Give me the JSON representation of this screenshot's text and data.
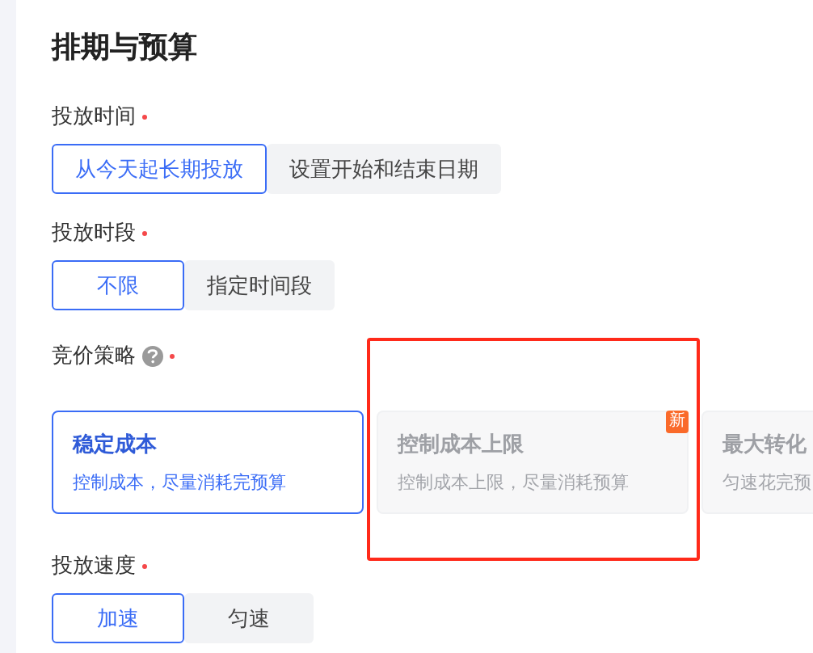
{
  "title": "排期与预算",
  "sections": [
    {
      "kind": "segmented",
      "label": "投放时间",
      "required": true,
      "options": [
        {
          "label": "从今天起长期投放",
          "selected": true
        },
        {
          "label": "设置开始和结束日期",
          "selected": false
        }
      ]
    },
    {
      "kind": "segmented",
      "label": "投放时段",
      "required": true,
      "options": [
        {
          "label": "不限",
          "selected": true
        },
        {
          "label": "指定时间段",
          "selected": false
        }
      ]
    },
    {
      "kind": "cards",
      "label": "竞价策略",
      "help": true,
      "required": true,
      "cards": [
        {
          "title": "稳定成本",
          "desc": "控制成本，尽量消耗完预算",
          "selected": true,
          "disabled": false,
          "highlighted": false
        },
        {
          "title": "控制成本上限",
          "desc": "控制成本上限，尽量消耗预算",
          "selected": false,
          "disabled": true,
          "highlighted": true,
          "badge": "新"
        },
        {
          "title": "最大转化",
          "desc": "匀速花完预",
          "selected": false,
          "disabled": true,
          "highlighted": false
        }
      ]
    },
    {
      "kind": "segmented",
      "label": "投放速度",
      "required": true,
      "options": [
        {
          "label": "加速",
          "selected": true
        },
        {
          "label": "匀速",
          "selected": false
        }
      ]
    }
  ]
}
